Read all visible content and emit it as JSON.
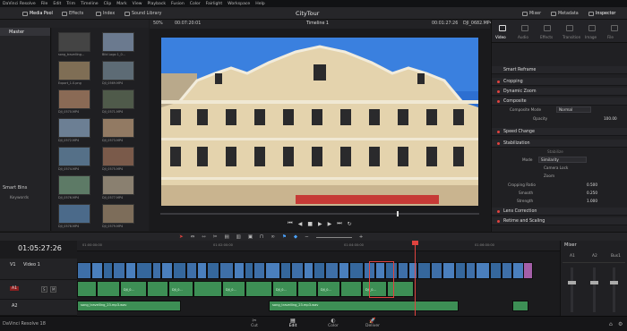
{
  "menu": [
    "DaVinci Resolve",
    "File",
    "Edit",
    "Trim",
    "Timeline",
    "Clip",
    "Mark",
    "View",
    "Playback",
    "Fusion",
    "Color",
    "Fairlight",
    "Workspace",
    "Help"
  ],
  "toolbar": {
    "media_pool": "Media Pool",
    "effects": "Effects",
    "index": "Index",
    "sound_library": "Sound Library",
    "project_title": "CityTour",
    "mixer": "Mixer",
    "metadata": "Metadata",
    "inspector": "Inspector"
  },
  "viewer": {
    "zoom": "50%",
    "timecode_in": "00:07:20:01",
    "timeline_name": "Timeline 1",
    "timecode_out": "00:01:27:26",
    "clip_name": "DJI_0682.MP4"
  },
  "media_pool": {
    "bin": "Master",
    "smart_bins": "Smart Bins",
    "keywords": "Keywords",
    "clips": [
      "song_travelling...",
      "Bild Logo 1_0...",
      "Export_1.0.png",
      "DJI_0569.MP4",
      "DJI_0570.MP4",
      "DJI_0571.MP4",
      "DJI_0572.MP4",
      "DJI_0573.MP4",
      "DJI_0574.MP4",
      "DJI_0575.MP4",
      "DJI_0576.MP4",
      "DJI_0577.MP4",
      "DJI_0578.MP4",
      "DJI_0579.MP4"
    ]
  },
  "inspector": {
    "tabs": [
      "Video",
      "Audio",
      "Effects",
      "Transition",
      "Image",
      "File"
    ],
    "rows": [
      "Smart Reframe",
      "Cropping",
      "Dynamic Zoom",
      "Composite",
      "Speed Change",
      "Stabilization",
      "Lens Correction",
      "Retime and Scaling"
    ],
    "composite_mode_label": "Composite Mode",
    "composite_mode_value": "Normal",
    "opacity_label": "Opacity",
    "opacity_value": "100.00",
    "stab_mode_label": "Mode",
    "stab_mode_value": "Similarity",
    "camera_lock": "Camera Lock",
    "zoom": "Zoom",
    "cropping_ratio_label": "Cropping Ratio",
    "cropping_ratio_value": "0.500",
    "smooth_label": "Smooth",
    "smooth_value": "0.250",
    "strength_label": "Strength",
    "strength_value": "1.000",
    "stabilize_btn": "Stabilize"
  },
  "timeline": {
    "current_tc": "01:05:27:26",
    "ruler": [
      "01:00:00:00",
      "01:02:00:00",
      "01:04:00:00",
      "01:06:00:00"
    ],
    "tracks": [
      {
        "id": "V1",
        "name": "Video 1"
      },
      {
        "id": "A1",
        "name": "A1"
      },
      {
        "id": "A2",
        "name": "A2"
      }
    ],
    "audio_clip_1": "song_travelling_23.mp3.wav",
    "audio_clip_2": "song_travelling_23.mp3.wav",
    "clip_label": "DJI_0..."
  },
  "mixer": {
    "title": "Mixer",
    "channels": [
      "A1",
      "A2",
      "Bus1"
    ]
  },
  "bottom": {
    "app": "DaVinci Resolve 18",
    "pages": [
      "Cut",
      "Edit",
      "Color",
      "Deliver"
    ]
  }
}
